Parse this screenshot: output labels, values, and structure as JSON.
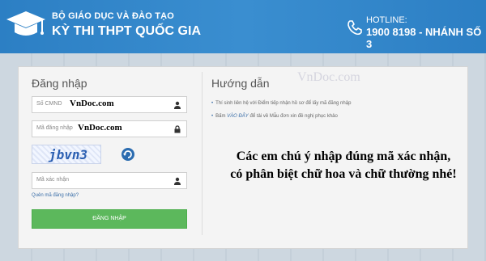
{
  "header": {
    "ministry": "BỘ GIÁO DỤC VÀ ĐÀO TẠO",
    "exam_title": "KỲ THI THPT QUỐC GIA",
    "hotline_label": "HOTLINE:",
    "hotline_number": "1900 8198 - NHÁNH SỐ 3"
  },
  "login": {
    "title": "Đăng nhập",
    "id_label": "Số CMND",
    "id_value": "VnDoc.com",
    "password_label": "Mã đăng nhập",
    "password_value": "VnDoc.com",
    "captcha_text": "jbvn3",
    "captcha_label": "Mã xác nhận",
    "forgot_label": "Quên mã đăng nhập?",
    "submit_label": "ĐĂNG NHẬP"
  },
  "guide": {
    "title": "Hướng dẫn",
    "item1": "Thí sinh liên hệ với Điểm tiếp nhận hồ sơ để lấy mã đăng nhập",
    "item2_prefix": "Bấm",
    "item2_link": "VÀO ĐÂY",
    "item2_suffix": "để tải về Mẫu đơn xin đề nghị phục khảo"
  },
  "watermark": "VnDoc.com",
  "note": {
    "line1": "Các em chú ý nhập đúng mã xác nhận,",
    "line2": "có phân biệt chữ hoa và chữ thường nhé!"
  },
  "colors": {
    "header_blue": "#2c7fc4",
    "button_green": "#5cb85c",
    "link_blue": "#3a6ea8"
  },
  "icons": [
    "graduation-cap-icon",
    "phone-icon",
    "user-icon",
    "lock-icon",
    "refresh-icon"
  ]
}
